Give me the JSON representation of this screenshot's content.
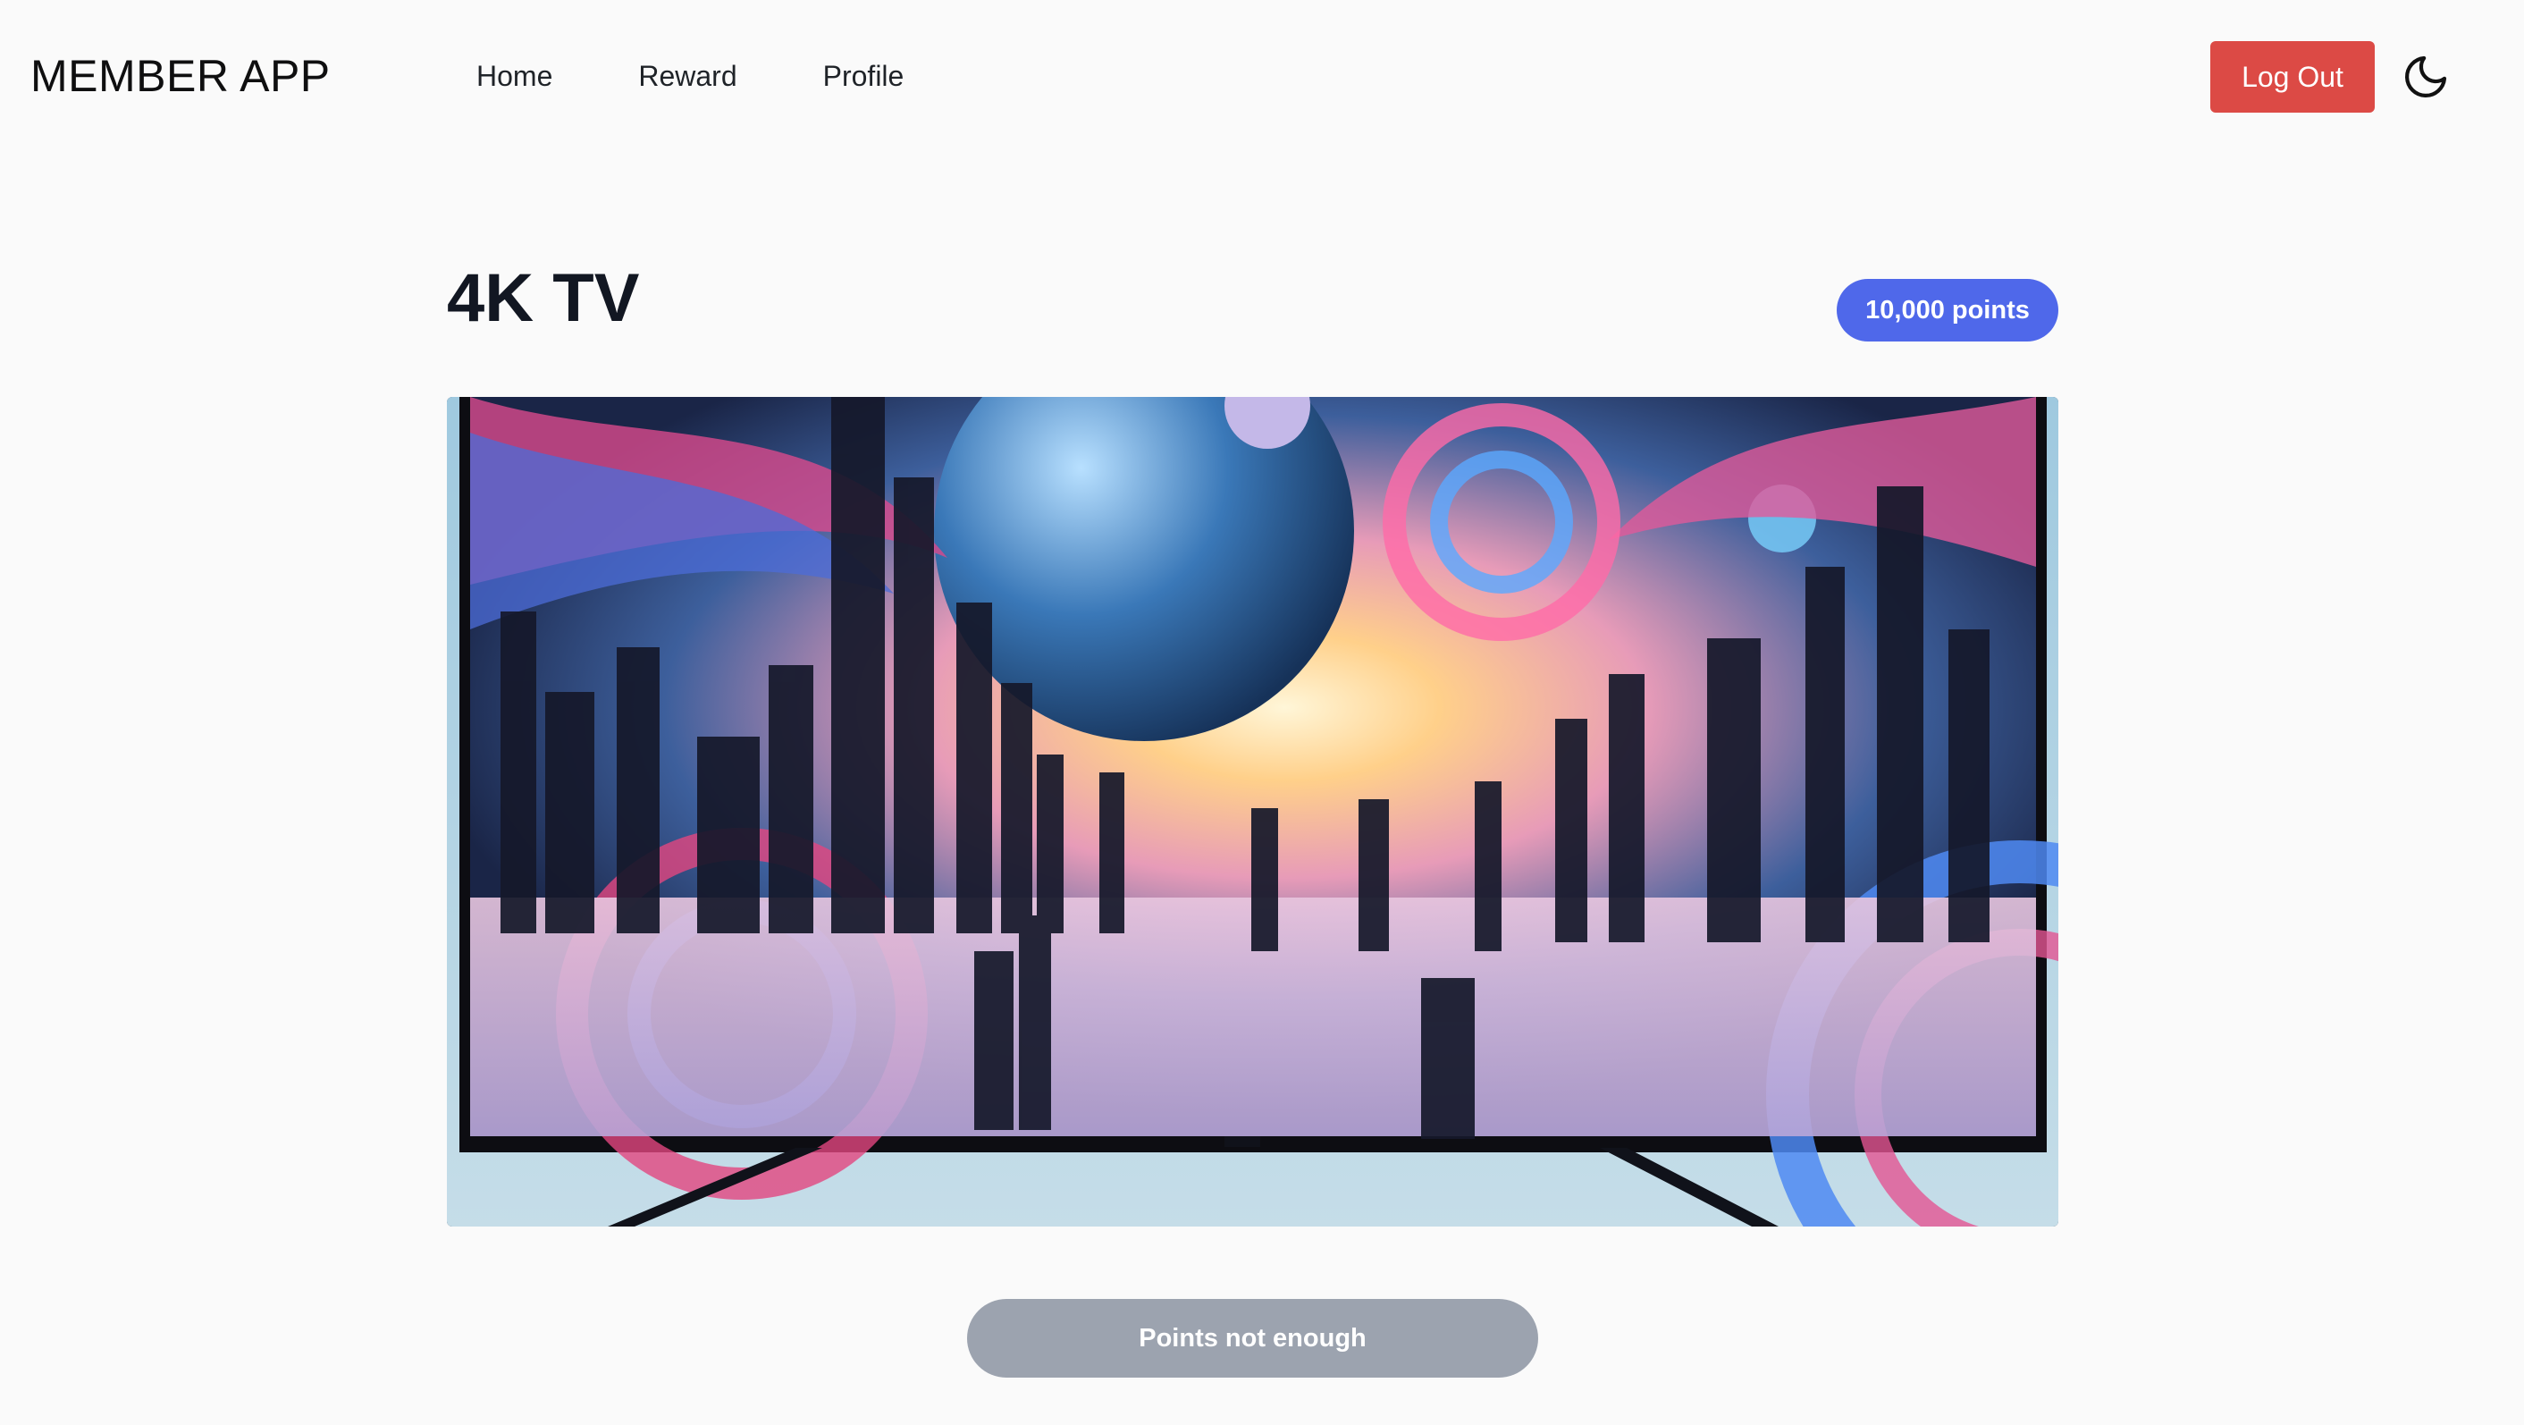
{
  "app": {
    "brand": "MEMBER APP",
    "nav": [
      {
        "label": "Home"
      },
      {
        "label": "Reward"
      },
      {
        "label": "Profile"
      }
    ],
    "logout_label": "Log Out",
    "theme_icon": "moon-icon"
  },
  "reward": {
    "title": "4K TV",
    "points_badge": "10,000 points",
    "image_alt": "4K TV",
    "redeem_label": "Points not enough",
    "redeem_enabled": false
  },
  "colors": {
    "background": "#fafafa",
    "logout": "#dc4a45",
    "badge": "#4f68ea",
    "disabled_button": "#9ca3af"
  }
}
